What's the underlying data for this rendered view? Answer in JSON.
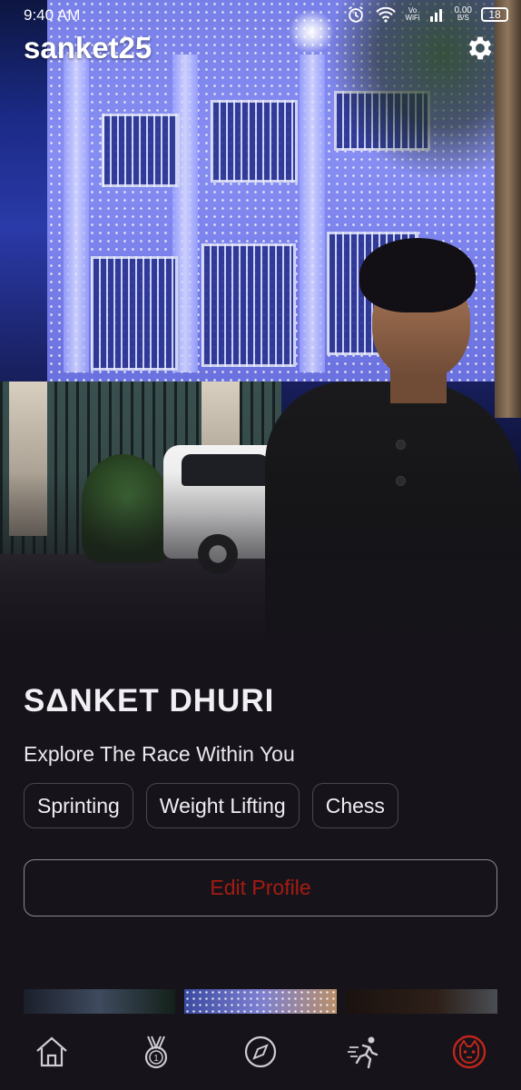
{
  "status_bar": {
    "time": "9:40 AM",
    "vowifi_top": "Vo",
    "vowifi_bottom": "WiFi",
    "net_speed_top": "0.00",
    "net_speed_bottom": "B/S",
    "battery": "18",
    "icons": [
      "alarm-icon",
      "wifi-icon",
      "signal-icon",
      "battery-icon"
    ]
  },
  "header": {
    "username": "sanket25",
    "settings_icon": "gear-icon"
  },
  "profile": {
    "full_name": "SΔNKET DHURI",
    "tagline": "Explore The Race Within You",
    "interests": [
      "Sprinting",
      "Weight Lifting",
      "Chess"
    ],
    "edit_label": "Edit Profile",
    "accent_color": "#a51b12"
  },
  "bottom_nav": {
    "items": [
      {
        "name": "home",
        "icon": "home-icon"
      },
      {
        "name": "medals",
        "icon": "medal-icon"
      },
      {
        "name": "explore",
        "icon": "compass-icon"
      },
      {
        "name": "activity",
        "icon": "runner-icon"
      },
      {
        "name": "profile",
        "icon": "profile-avatar-icon",
        "active": true
      }
    ]
  }
}
